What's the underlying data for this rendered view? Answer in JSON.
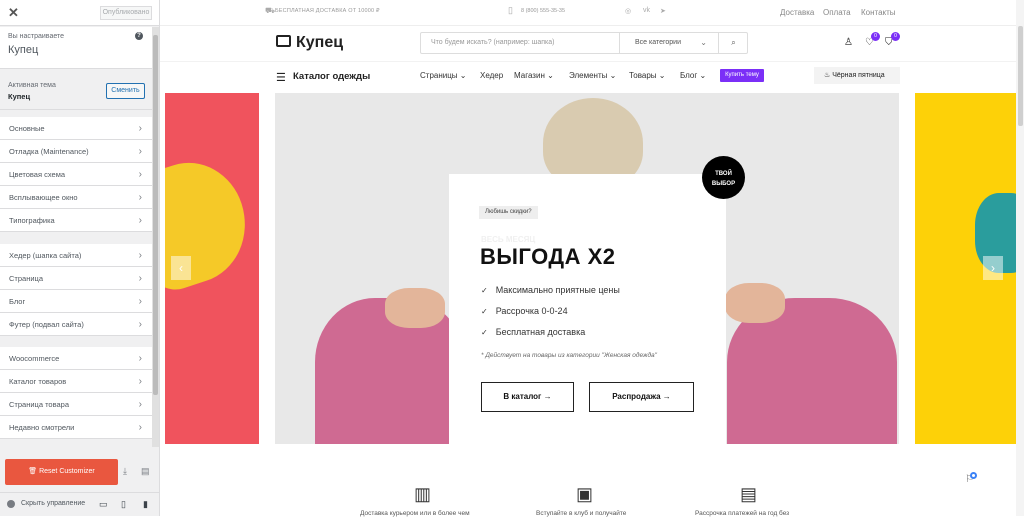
{
  "customizer": {
    "close_icon": "✕",
    "publish_label": "Опубликовано",
    "editing_label": "Вы настраиваете",
    "editing_title": "Купец",
    "help_icon": "?",
    "active_theme_label": "Активная тема",
    "active_theme_name": "Купец",
    "change_label": "Сменить",
    "groups": [
      [
        "Основные",
        "Отладка (Maintenance)",
        "Цветовая схема",
        "Всплывающее окно",
        "Типографика"
      ],
      [
        "Хедер (шапка сайта)",
        "Страница",
        "Блог",
        "Футер (подвал сайта)"
      ],
      [
        "Woocommerce",
        "Каталог товаров",
        "Страница товара",
        "Недавно смотрели"
      ]
    ],
    "reset_label": "Reset Customizer",
    "hide_label": "Скрыть управление"
  },
  "site": {
    "topbar": {
      "shipping": "БЕСПЛАТНАЯ ДОСТАВКА ОТ 10000 ₽",
      "phone": "8 (800) 555-35-35",
      "links": [
        "Доставка",
        "Оплата",
        "Контакты"
      ]
    },
    "header": {
      "logo": "Купец",
      "search_placeholder": "Что будем искать? (например: шапка)",
      "category_select": "Все категории",
      "wishlist_count": "0",
      "cart_count": "0"
    },
    "nav": {
      "catalog": "Каталог одежды",
      "items": [
        "Страницы",
        "Хедер",
        "Магазин",
        "Элементы",
        "Товары",
        "Блог"
      ],
      "buy_label": "Купить тему",
      "black_friday": "Чёрная пятница"
    },
    "hero": {
      "tag": "Любишь скидки?",
      "subtitle_ghost": "ВЕСЬ МЕСЯЦ",
      "headline": "ВЫГОДА Х2",
      "features": [
        "Максимально приятные цены",
        "Рассрочка 0-0-24",
        "Бесплатная доставка"
      ],
      "note": "* Действует на товары из категории \"Женская одежда\"",
      "btn_catalog": "В каталог",
      "btn_sale": "Распродажа",
      "circle_line1": "ТВОЙ",
      "circle_line2": "ВЫБОР"
    },
    "features_row": [
      "Доставка курьером или в более чем",
      "Вступайте в клуб и получайте",
      "Рассрочка платежей на год без"
    ]
  }
}
